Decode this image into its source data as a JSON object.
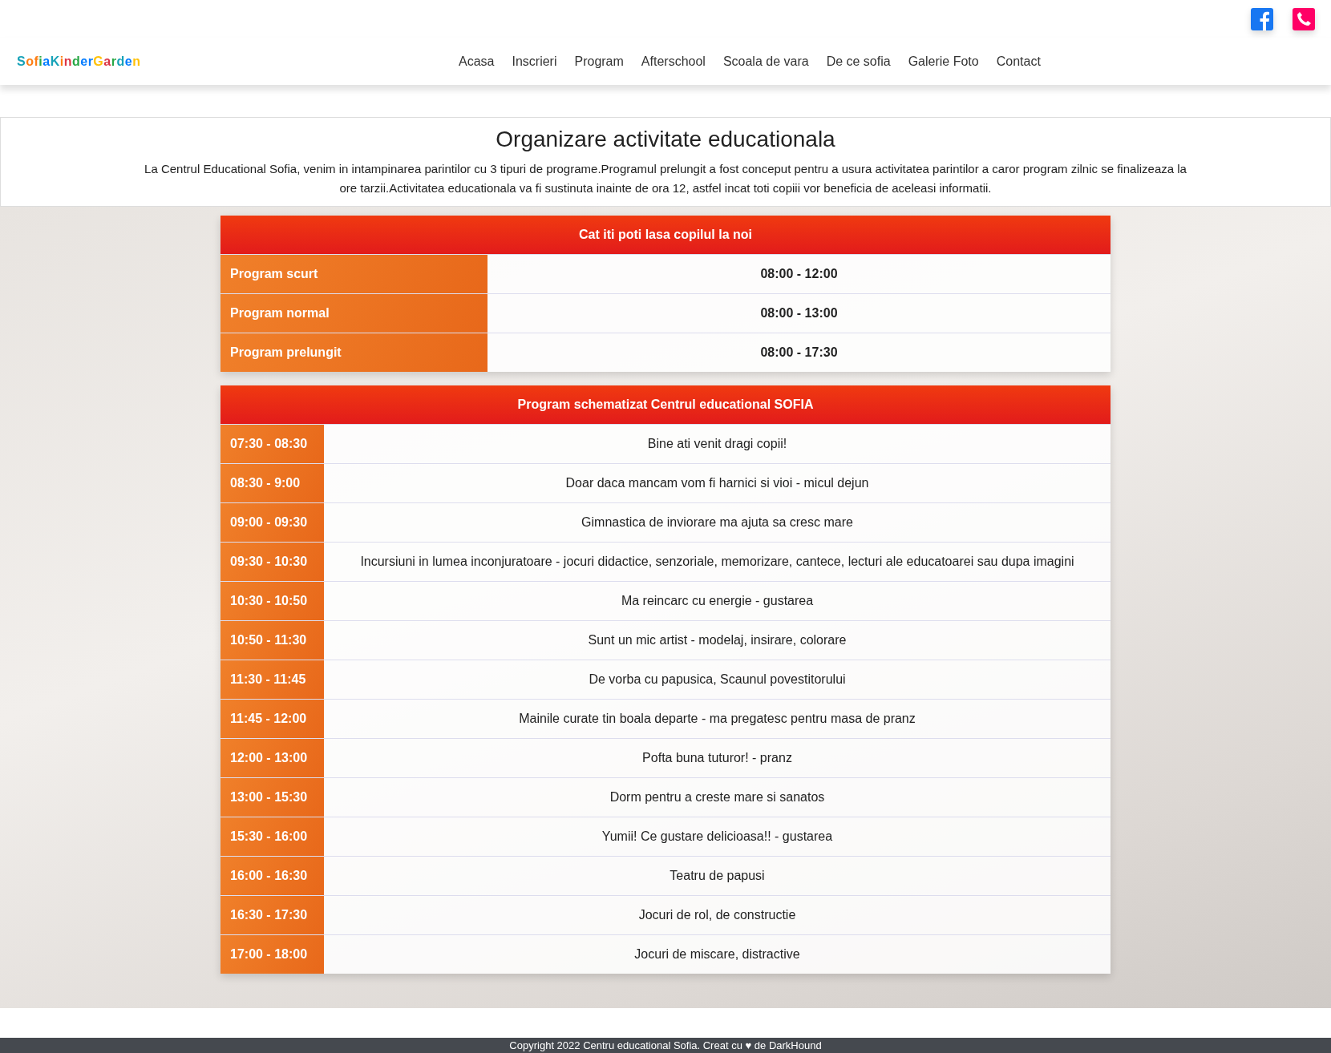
{
  "top_bar": {
    "icons": [
      {
        "kind": "facebook",
        "color": "#1877f2"
      },
      {
        "kind": "phone",
        "color": "#ff0066"
      }
    ]
  },
  "navbar": {
    "logo": [
      {
        "text": "S",
        "color": "#17a2b8"
      },
      {
        "text": "o",
        "color": "#fd7e14"
      },
      {
        "text": "f",
        "color": "#fd7e14"
      },
      {
        "text": "i",
        "color": "#28a745"
      },
      {
        "text": "a",
        "color": "#007bff"
      },
      {
        "text": "K",
        "color": "#17a2b8"
      },
      {
        "text": "i",
        "color": "#fd7e14"
      },
      {
        "text": "n",
        "color": "#dc3545"
      },
      {
        "text": "d",
        "color": "#28a745"
      },
      {
        "text": "e",
        "color": "#007bff"
      },
      {
        "text": "r",
        "color": "#007bff"
      },
      {
        "text": "G",
        "color": "#ffc107"
      },
      {
        "text": "a",
        "color": "#dc3545"
      },
      {
        "text": "r",
        "color": "#28a745"
      },
      {
        "text": "d",
        "color": "#17a2b8"
      },
      {
        "text": "e",
        "color": "#007bff"
      },
      {
        "text": "n",
        "color": "#ffc107"
      }
    ],
    "links": [
      "Acasa",
      "Inscrieri",
      "Program",
      "Afterschool",
      "Scoala de vara",
      "De ce sofia",
      "Galerie Foto",
      "Contact"
    ]
  },
  "intro": {
    "title": "Organizare activitate educationala",
    "text": "La Centrul Educational Sofia, venim in intampinarea parintilor cu 3 tipuri de programe.Programul prelungit a fost conceput pentru a usura activitatea parintilor a caror program zilnic se finalizeaza la ore tarzii.Activitatea educationala va fi sustinuta inainte de ora 12, astfel incat toti copiii vor beneficia de aceleasi informatii."
  },
  "tables": [
    {
      "title": "Cat iti poti lasa copilul la noi",
      "kind": "hours",
      "rows": [
        {
          "label": "Program scurt",
          "value": "08:00 - 12:00"
        },
        {
          "label": "Program normal",
          "value": "08:00 - 13:00"
        },
        {
          "label": "Program prelungit",
          "value": "08:00 - 17:30"
        }
      ]
    },
    {
      "title": "Program schematizat Centrul educational SOFIA",
      "kind": "schedule",
      "rows": [
        {
          "label": "07:30 - 08:30",
          "value": "Bine ati venit dragi copii!"
        },
        {
          "label": "08:30 - 9:00",
          "value": "Doar daca mancam vom fi harnici si vioi - micul dejun"
        },
        {
          "label": "09:00 - 09:30",
          "value": "Gimnastica de inviorare ma ajuta sa cresc mare"
        },
        {
          "label": "09:30 - 10:30",
          "value": "Incursiuni in lumea inconjuratoare - jocuri didactice, senzoriale, memorizare, cantece, lecturi ale educatoarei sau dupa imagini"
        },
        {
          "label": "10:30 - 10:50",
          "value": "Ma reincarc cu energie - gustarea"
        },
        {
          "label": "10:50 - 11:30",
          "value": "Sunt un mic artist - modelaj, insirare, colorare"
        },
        {
          "label": "11:30 - 11:45",
          "value": "De vorba cu papusica, Scaunul povestitorului"
        },
        {
          "label": "11:45 - 12:00",
          "value": "Mainile curate tin boala departe - ma pregatesc pentru masa de pranz"
        },
        {
          "label": "12:00 - 13:00",
          "value": "Pofta buna tuturor! - pranz"
        },
        {
          "label": "13:00 - 15:30",
          "value": "Dorm pentru a creste mare si sanatos"
        },
        {
          "label": "15:30 - 16:00",
          "value": "Yumii! Ce gustare delicioasa!! - gustarea"
        },
        {
          "label": "16:00 - 16:30",
          "value": "Teatru de papusi"
        },
        {
          "label": "16:30 - 17:30",
          "value": "Jocuri de rol, de constructie"
        },
        {
          "label": "17:00 - 18:00",
          "value": "Jocuri de miscare, distractive"
        }
      ]
    }
  ],
  "footer": {
    "text": "Copyright 2022 Centru educational Sofia. Creat cu ♥ de DarkHound"
  }
}
